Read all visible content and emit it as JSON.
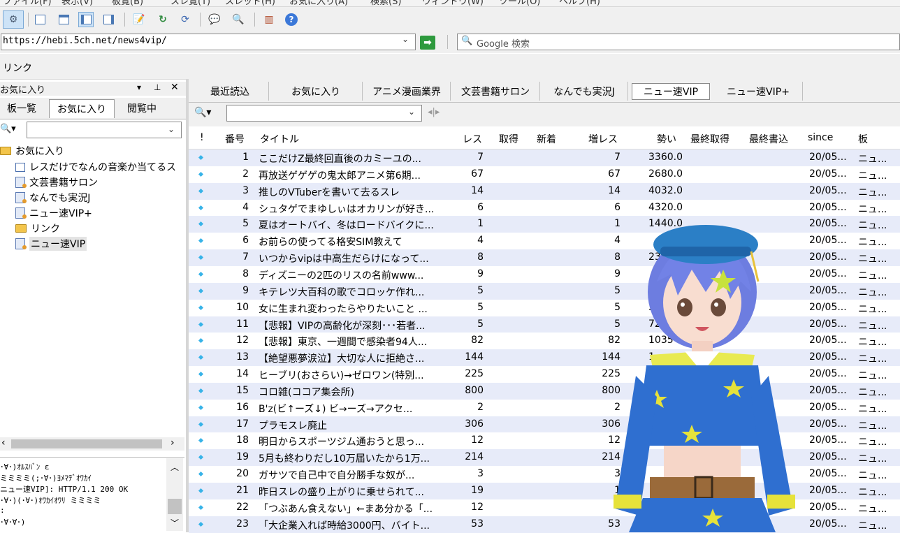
{
  "menubar": {
    "items": [
      "ファイル(F)",
      "表示(V)",
      "板覧(B)",
      "スレ覧(T)",
      "スレッド(H)",
      "お気に入り(A)",
      "検索(S)",
      "ウィンドウ(W)",
      "ツール(O)",
      "ヘルプ(H)"
    ]
  },
  "toolbar": {
    "icons": [
      "board-list-icon",
      "panel-layout-icon",
      "new-thread-icon",
      "refresh-icon",
      "search-icon",
      "help-icon"
    ]
  },
  "address": {
    "url": "https://hebi.5ch.net/news4vip/",
    "go_label": "➡",
    "search_placeholder": "Google 検索",
    "search_icon": "🔍"
  },
  "links": {
    "label": "リンク"
  },
  "left_panel": {
    "title": "お気に入り",
    "controls": [
      "▾",
      "⊥",
      "✕"
    ],
    "tabs": [
      "板一覧",
      "お気に入り",
      "閲覧中"
    ],
    "tree": [
      {
        "label": "お気に入り",
        "type": "folder"
      },
      {
        "label": "レスだけでなんの音楽か当てるス",
        "type": "thread"
      },
      {
        "label": "文芸書籍サロン",
        "type": "board"
      },
      {
        "label": "なんでも実況J",
        "type": "board"
      },
      {
        "label": "ニュー速VIP+",
        "type": "board"
      },
      {
        "label": "リンク",
        "type": "folder"
      },
      {
        "label": "ニュー速VIP",
        "type": "board"
      }
    ],
    "log": [
      "･∀･)ｵﾙｽﾊﾞﾝ          ε",
      "ミミミミ(;･∀･)ﾖﾒﾏﾃﾞｵﾜｶｲ",
      "ニュー速VIP]: HTTP/1.1 200 OK",
      "･∀･)(･∀･)ｵﾜｶｲｵﾜﾘ  ミミミミ",
      ":",
      "･∀･∀･)"
    ]
  },
  "board_tabs": [
    "最近読込",
    "お気に入り",
    "アニメ漫画業界",
    "文芸書籍サロン",
    "なんでも実況J",
    "ニュー速VIP",
    "ニュー速VIP+"
  ],
  "active_tab": 5,
  "thread_list": {
    "columns": [
      "!",
      "番号",
      "タイトル",
      "レス",
      "取得",
      "新着",
      "増レス",
      "勢い",
      "最終取得",
      "最終書込",
      "since",
      "板"
    ],
    "rows": [
      [
        "1",
        "ここだけZ最終回直後のカミーユの...",
        "7",
        "7",
        "3360.0"
      ],
      [
        "2",
        "再放送ゲゲゲの鬼太郎アニメ第6期...",
        "67",
        "67",
        "2680.0"
      ],
      [
        "3",
        "推しのVTuberを書いて去るスレ",
        "14",
        "14",
        "4032.0"
      ],
      [
        "4",
        "シュタゲでまゆしぃはオカリンが好き...",
        "6",
        "6",
        "4320.0"
      ],
      [
        "5",
        "夏はオートバイ、冬はロードバイクに...",
        "1",
        "1",
        "1440.0"
      ],
      [
        "6",
        "お前らの使ってる格安SIM教えて",
        "4",
        "4",
        ""
      ],
      [
        "7",
        "いつからvipは中高生だらけになって...",
        "8",
        "8",
        "23"
      ],
      [
        "8",
        "ディズニーの2匹のリスの名前www...",
        "9",
        "9",
        ""
      ],
      [
        "9",
        "キテレツ大百科の歌でコロッケ作れ...",
        "5",
        "5",
        "3"
      ],
      [
        "10",
        "女に生まれ変わったらやりたいこと ...",
        "5",
        "5",
        "36"
      ],
      [
        "11",
        "【悲報】VIPの高齢化が深刻･･･若者...",
        "5",
        "5",
        "720"
      ],
      [
        "12",
        "【悲報】東京、一週間で感染者94人...",
        "82",
        "82",
        "1035"
      ],
      [
        "13",
        "【絶望悪夢涙泣】大切な人に拒絶さ...",
        "144",
        "144",
        "1"
      ],
      [
        "14",
        "ヒーブリ(おさらい)→ゼロワン(特別...",
        "225",
        "225",
        ""
      ],
      [
        "15",
        "コロ雑(ココア集会所)",
        "800",
        "800",
        ""
      ],
      [
        "16",
        "B'z(ビ↑ーズ↓) ビ→ーズ→アクセ...",
        "2",
        "2",
        ""
      ],
      [
        "17",
        "プラモスレ廃止",
        "306",
        "306",
        ""
      ],
      [
        "18",
        "明日からスポーツジム通おうと思っ...",
        "12",
        "12",
        ""
      ],
      [
        "19",
        "5月も終わりだし10万届いたから1万...",
        "214",
        "214",
        ""
      ],
      [
        "20",
        "ガサツで自己中で自分勝手な奴が...",
        "3",
        "3",
        ""
      ],
      [
        "21",
        "昨日スレの盛り上がりに乗せられて...",
        "19",
        "1",
        ""
      ],
      [
        "22",
        "「つぶあん食えない」←まあ分かる「...",
        "12",
        "",
        ""
      ],
      [
        "23",
        "「大企業入れば時給3000円、バイト...",
        "53",
        "53",
        ""
      ]
    ],
    "since": "20/05...",
    "board": "ニュ..."
  }
}
